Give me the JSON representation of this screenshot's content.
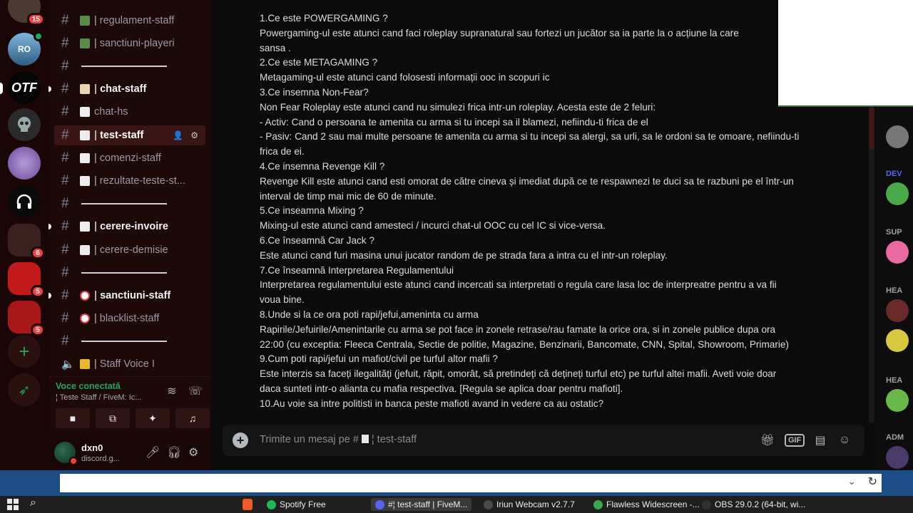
{
  "servers": [
    {
      "id": "s0",
      "badge": "15"
    },
    {
      "id": "s1",
      "label": "RO"
    },
    {
      "id": "s2",
      "label": "OTF"
    },
    {
      "id": "s3",
      "label": ""
    },
    {
      "id": "s4",
      "label": ""
    },
    {
      "id": "s5",
      "label": ""
    },
    {
      "id": "s6",
      "badge": "6"
    },
    {
      "id": "s7",
      "badge": "5"
    },
    {
      "id": "s8",
      "badge": "5"
    }
  ],
  "channels": [
    {
      "name": "regulament-staff",
      "state": "normal"
    },
    {
      "name": "sanctiuni-playeri",
      "state": "normal"
    },
    {
      "name": "",
      "state": "separator"
    },
    {
      "name": "chat-staff",
      "state": "bold"
    },
    {
      "name": "chat-hs",
      "state": "normal"
    },
    {
      "name": "test-staff",
      "state": "selected"
    },
    {
      "name": "comenzi-staff",
      "state": "normal"
    },
    {
      "name": "rezultate-teste-st...",
      "state": "normal"
    },
    {
      "name": "",
      "state": "separator"
    },
    {
      "name": "cerere-invoire",
      "state": "bold"
    },
    {
      "name": "cerere-demisie",
      "state": "normal"
    },
    {
      "name": "",
      "state": "separator"
    },
    {
      "name": "sanctiuni-staff",
      "state": "bold"
    },
    {
      "name": "blacklist-staff",
      "state": "normal"
    },
    {
      "name": "",
      "state": "separator"
    },
    {
      "name": "Staff Voice I",
      "state": "voice"
    }
  ],
  "voice": {
    "status": "Voce conectată",
    "channel": "¦ Teste Staff / FiveM: Ic..."
  },
  "user": {
    "name": "dxn0",
    "status": "discord.g..."
  },
  "message_lines": [
    "1.Ce este POWERGAMING ?",
    "Powergaming-ul este atunci cand faci roleplay supranatural sau fortezi un jucător sa ia parte la o acțiune la care",
    "sansa .",
    "2.Ce este METAGAMING ?",
    "Metagaming-ul este atunci cand folosesti informații ooc in scopuri ic",
    "3.Ce insemna Non-Fear?",
    "Non Fear Roleplay este atunci cand nu simulezi frica intr-un roleplay. Acesta este de 2 feluri:",
    "- Activ: Cand o persoana te amenita cu arma si tu incepi sa il blamezi, nefiindu-ti frica de el",
    "- Pasiv: Cand 2 sau mai multe persoane te amenita cu arma si tu incepi sa alergi, sa urli, sa le ordoni sa te omoare, nefiindu-ti",
    "frica de ei.",
    "4.Ce insemna Revenge Kill ?",
    "Revenge Kill este atunci cand esti omorat de către cineva și imediat după ce te respawnezi te duci sa te razbuni pe el într-un",
    "interval de timp mai mic de 60 de minute.",
    "5.Ce inseamna Mixing ?",
    "Mixing-ul este atunci cand amesteci / incurci chat-ul OOC cu cel IC si vice-versa.",
    "6.Ce înseamnă Car Jack ?",
    "Este atunci cand furi masina unui jucator random de pe strada fara a intra cu el intr-un roleplay.",
    "7.Ce înseamnă Interpretarea Regulamentului",
    "Interpretarea regulamentului este atunci cand incercati sa interpretati o regula care lasa loc de interpreatre pentru a va fii",
    "voua bine.",
    "8.Unde si la ce ora poti rapi/jefui,amenintа cu arma",
    "Rapirile/Jefuirile/Amenintarile cu arma se pot face in zonele retrase/rau famate la orice ora, si in zonele publice dupa ora",
    "22:00 (cu exceptia: Fleeca Centrala, Sectie de politie, Magazine, Benzinarii, Bancomate, CNN, Spital, Showroom, Primarie)",
    "9.Cum poti rapi/jefui un mafiot/civil pe turful altor mafii ?",
    "Este interzis sa faceți ilegalități (jefuit, răpit, omorât, să pretindeți că dețineți turful etc) pe turful altei mafii. Aveti voie doar",
    "daca sunteti intr-o alianta cu mafia respectiva.  [Regula se aplica doar pentru mafioti].",
    "10.Au voie sa intre politisti in banca peste mafioti avand in vedere ca au ostatic?"
  ],
  "composer": {
    "placeholder": "Trimite un mesaj pe #",
    "channel": "¦ test-staff",
    "gif_label": "GIF"
  },
  "member_groups": [
    "DEV",
    "SUP",
    "HEA",
    "HEA",
    "ADM"
  ],
  "taskbar": [
    {
      "label": "Spotify Free",
      "color": "#1db954"
    },
    {
      "label": "#¦ test-staff | FiveM...",
      "color": "#5865f2",
      "active": true
    },
    {
      "label": "Iriun Webcam v2.7.7",
      "color": "#4a4a4a"
    },
    {
      "label": "Flawless Widescreen -...",
      "color": "#3aa84a"
    },
    {
      "label": "OBS 29.0.2 (64-bit, wi...",
      "color": "#303030"
    }
  ],
  "colors": {
    "accent_green": "#23a55a",
    "badge_red": "#f23f42",
    "selected_bg": "#3a1515"
  }
}
